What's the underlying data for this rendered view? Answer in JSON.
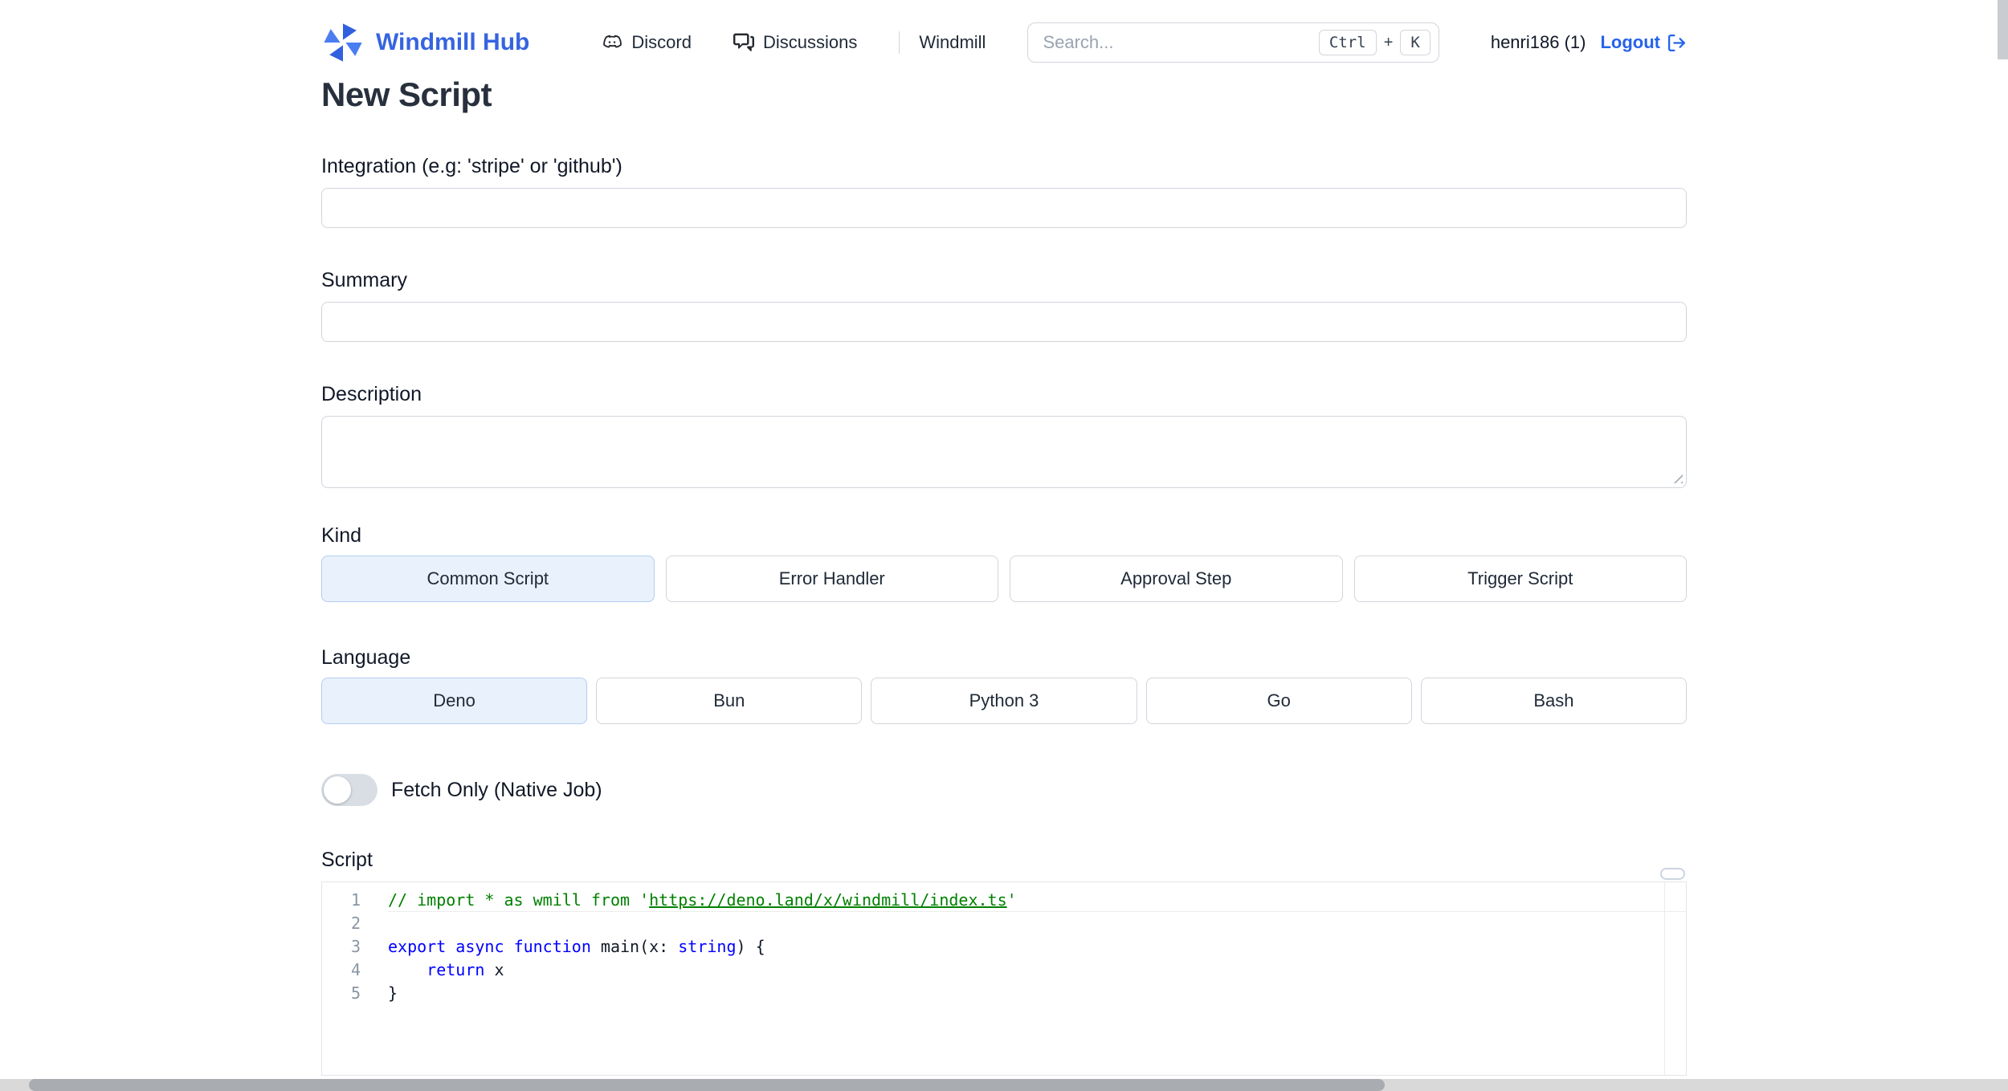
{
  "header": {
    "brand": "Windmill Hub",
    "nav": [
      {
        "label": "Discord",
        "icon": "discord-icon"
      },
      {
        "label": "Discussions",
        "icon": "comment-discussion-icon"
      },
      {
        "label": "Windmill",
        "icon": "none"
      }
    ],
    "search": {
      "placeholder": "Search...",
      "shortcut": {
        "key1": "Ctrl",
        "separator": "+",
        "key2": "K"
      }
    },
    "user": "henri186 (1)",
    "logout_label": "Logout"
  },
  "page": {
    "title": "New Script",
    "integration": {
      "label": "Integration (e.g: 'stripe' or 'github')",
      "value": ""
    },
    "summary": {
      "label": "Summary",
      "value": ""
    },
    "description": {
      "label": "Description",
      "value": ""
    },
    "kind": {
      "label": "Kind",
      "options": [
        "Common Script",
        "Error Handler",
        "Approval Step",
        "Trigger Script"
      ],
      "selected": "Common Script"
    },
    "language": {
      "label": "Language",
      "options": [
        "Deno",
        "Bun",
        "Python 3",
        "Go",
        "Bash"
      ],
      "selected": "Deno"
    },
    "fetch_only": {
      "label": "Fetch Only (Native Job)",
      "enabled": false
    },
    "script": {
      "label": "Script",
      "code_lines": [
        {
          "num": "1",
          "tokens": [
            {
              "t": "// import * as wmill from '",
              "c": "comment"
            },
            {
              "t": "https://deno.land/x/windmill/index.ts",
              "c": "comment-link"
            },
            {
              "t": "'",
              "c": "comment"
            }
          ]
        },
        {
          "num": "2",
          "tokens": []
        },
        {
          "num": "3",
          "tokens": [
            {
              "t": "export",
              "c": "keyword"
            },
            {
              "t": " ",
              "c": "plain"
            },
            {
              "t": "async",
              "c": "keyword"
            },
            {
              "t": " ",
              "c": "plain"
            },
            {
              "t": "function",
              "c": "keyword"
            },
            {
              "t": " main(x: ",
              "c": "plain"
            },
            {
              "t": "string",
              "c": "type"
            },
            {
              "t": ") {",
              "c": "plain"
            }
          ]
        },
        {
          "num": "4",
          "tokens": [
            {
              "t": "    ",
              "c": "plain"
            },
            {
              "t": "return",
              "c": "keyword"
            },
            {
              "t": " x",
              "c": "plain"
            }
          ]
        },
        {
          "num": "5",
          "tokens": [
            {
              "t": "}",
              "c": "plain"
            }
          ]
        }
      ]
    }
  },
  "colors": {
    "brand_blue": "#3664e0",
    "link_blue": "#2563eb",
    "selected_option_bg": "#e9f1fc",
    "selected_option_border": "#b3cdf1",
    "comment_green": "#008000",
    "keyword_blue": "#0000ff",
    "border_gray": "#d1d5db"
  }
}
